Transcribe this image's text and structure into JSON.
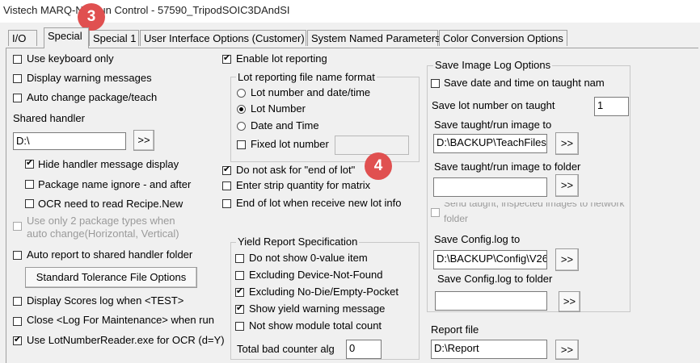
{
  "window": {
    "title": "Vistech MARQ-NT Run Control - 57590_TripodSOIC3DAndSI"
  },
  "tabs": [
    {
      "label": "I/O"
    },
    {
      "label": "Special"
    },
    {
      "label": "Special 1"
    },
    {
      "label": "User Interface Options (Customer)"
    },
    {
      "label": "System Named Parameters"
    },
    {
      "label": "Color Conversion Options"
    }
  ],
  "markers": {
    "m3": "3",
    "m4": "4"
  },
  "left": {
    "use_keyboard_only": "Use keyboard only",
    "display_warning": "Display warning messages",
    "auto_change": "Auto change package/teach",
    "shared_handler_label": "Shared handler",
    "shared_handler_value": "D:\\",
    "browse": ">>",
    "hide_handler": "Hide handler message display",
    "pkg_name_ignore": "Package name ignore - and after",
    "ocr_need": "OCR need to read Recipe.New",
    "only2_line1": "Use only 2 package types when",
    "only2_line2": "auto change(Horizontal, Vertical)",
    "auto_report": "Auto report to shared handler folder",
    "std_tol_btn": "Standard Tolerance File Options",
    "display_scores": "Display Scores log when <TEST>",
    "close_log": "Close <Log For Maintenance> when run",
    "use_lotnumber": "Use LotNumberReader.exe for OCR (d=Y)"
  },
  "middle": {
    "enable_lot": "Enable lot reporting",
    "lot_group_title": "Lot reporting file name format",
    "radio_lot_date": "Lot number and date/time",
    "radio_lot_number": "Lot Number",
    "radio_date_time": "Date and Time",
    "fixed_lot": "Fixed lot number",
    "do_not_ask": "Do not ask for \"end of lot\"",
    "enter_strip": "Enter strip quantity for matrix",
    "end_of_lot": "End of lot when receive new lot info",
    "yield_title": "Yield Report Specification",
    "no_zero": "Do not show 0-value item",
    "excl_not_found": "Excluding Device-Not-Found",
    "excl_no_die": "Excluding No-Die/Empty-Pocket",
    "show_yield_warning": "Show yield warning message",
    "not_show_module": "Not show module total count",
    "total_bad_label": "Total bad counter alg",
    "total_bad_value": "0"
  },
  "right": {
    "group_title": "Save Image  Log Options",
    "save_date_time": "Save date and time on taught name",
    "save_lot_label": "Save lot number on taught",
    "save_lot_value": "1",
    "taught_run_label": "Save taught/run image to",
    "taught_run_value": "D:\\BACKUP\\TeachFiles\\V",
    "taught_run_folder_label": "Save taught/run image to folder",
    "taught_run_folder_value": "",
    "send_taught_line1": "Send taught, inspected images to network",
    "send_taught_line2": "folder",
    "config_label": "Save Config.log to",
    "config_value": "D:\\BACKUP\\Config\\V26",
    "config_folder_label": "Save Config.log to folder",
    "config_folder_value": "",
    "report_label": "Report file",
    "report_value": "D:\\Report"
  }
}
